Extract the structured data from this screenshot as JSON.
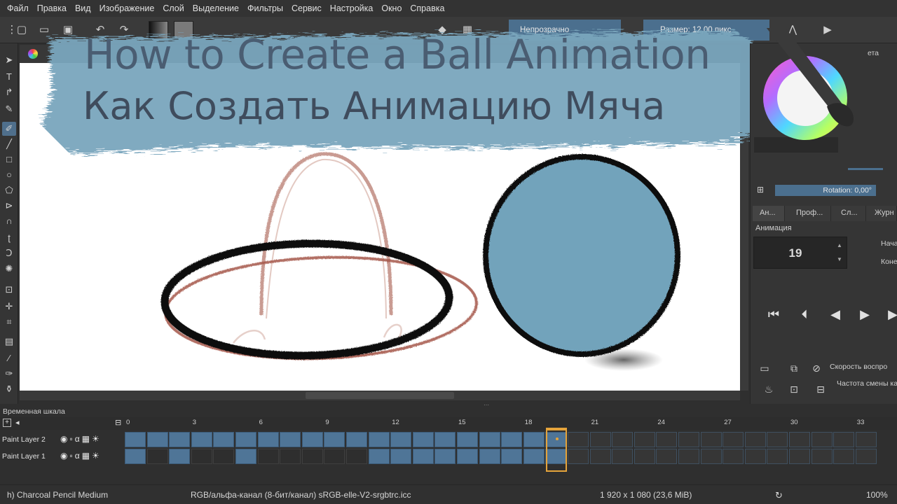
{
  "menu": [
    "Файл",
    "Правка",
    "Вид",
    "Изображение",
    "Слой",
    "Выделение",
    "Фильтры",
    "Сервис",
    "Настройка",
    "Окно",
    "Справка"
  ],
  "toolbar": {
    "opacity_label": "Непрозрачно",
    "size_label": "Размер: 12,00 пикс"
  },
  "banner": {
    "title_en": "How to Create a Ball Animation",
    "title_ru": "Как Создать Анимацию Мяча"
  },
  "dock": {
    "top_label": "ета",
    "rotation": "Rotation: 0,00°",
    "tabs": [
      "Ан...",
      "Проф...",
      "Сл...",
      "Журн"
    ],
    "animation_label": "Анимация",
    "current_frame": "19",
    "start_label": "Нача",
    "end_label": "Коне",
    "speed_label": "Скорость воспро",
    "framerate_label": "Частота смены ка"
  },
  "timeline": {
    "title": "Временная шкала",
    "frame_numbers": [
      "0",
      "3",
      "6",
      "9",
      "12",
      "15",
      "18",
      "21",
      "24",
      "27",
      "30",
      "33"
    ],
    "current_frame": 19,
    "layers": [
      {
        "name": "Paint Layer 2",
        "cells": [
          "blue",
          "blue",
          "blue",
          "blue",
          "blue",
          "blue",
          "blue",
          "blue",
          "blue",
          "blue",
          "blue",
          "blue",
          "blue",
          "blue",
          "blue",
          "blue",
          "blue",
          "blue",
          "blue",
          "blue",
          "empty",
          "empty",
          "empty",
          "empty",
          "empty",
          "empty",
          "empty",
          "empty",
          "empty",
          "empty",
          "empty",
          "empty",
          "empty",
          "empty"
        ]
      },
      {
        "name": "Paint Layer 1",
        "cells": [
          "blue",
          "dark",
          "blue",
          "dark",
          "dark",
          "blue",
          "dark",
          "dark",
          "dark",
          "dark",
          "dark",
          "blue",
          "blue",
          "blue",
          "blue",
          "blue",
          "blue",
          "blue",
          "blue",
          "blue",
          "empty",
          "empty",
          "empty",
          "empty",
          "empty",
          "empty",
          "empty",
          "empty",
          "empty",
          "empty",
          "empty",
          "empty",
          "empty",
          "empty"
        ]
      }
    ]
  },
  "status": {
    "brush": "h) Charcoal Pencil Medium",
    "color_space": "RGB/альфа-канал (8-бит/канал)  sRGB-elle-V2-srgbtrc.icc",
    "dimensions": "1 920 x 1 080 (23,6 MiB)",
    "zoom": "100%"
  },
  "colors": {
    "accent": "#4b6f8e",
    "ball_fill": "#72a3bb",
    "sketch": "#b56a5c",
    "banner": "#7aa6bd",
    "playhead": "#e5a43b"
  }
}
